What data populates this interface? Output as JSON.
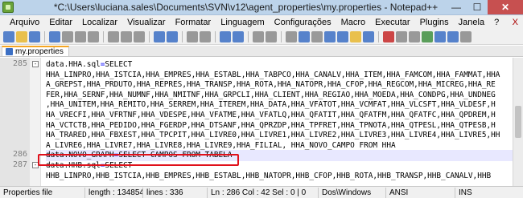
{
  "window": {
    "title": "*C:\\Users\\luciana.sales\\Documents\\SVN\\v12\\agent_properties\\my.properties - Notepad++",
    "minimize_symbol": "—",
    "maximize_symbol": "☐",
    "close_symbol": "✕"
  },
  "menu": {
    "items": [
      "Arquivo",
      "Editar",
      "Localizar",
      "Visualizar",
      "Formatar",
      "Linguagem",
      "Configurações",
      "Macro",
      "Executar",
      "Plugins",
      "Janela",
      "?"
    ],
    "close_symbol": "X"
  },
  "toolbar": {
    "icons": [
      "new-file-icon",
      "open-file-icon",
      "save-icon",
      "save-all-icon",
      "close-file-icon",
      "close-all-icon",
      "print-icon",
      "cut-icon",
      "copy-icon",
      "paste-icon",
      "undo-icon",
      "redo-icon",
      "find-icon",
      "replace-icon",
      "zoom-in-icon",
      "zoom-out-icon",
      "sync-v-icon",
      "sync-h-icon",
      "word-wrap-icon",
      "show-all-chars-icon",
      "indent-guide-icon",
      "doc-map-icon",
      "function-list-icon",
      "folder-icon",
      "monitor-icon",
      "record-macro-icon",
      "stop-macro-icon",
      "play-macro-icon",
      "run-macro-icon",
      "save-macro-icon",
      "spell-check-icon",
      "abc-icon"
    ],
    "colors": {
      "blue": "#3b6fc4",
      "yellow": "#e8b730",
      "red": "#c62828",
      "gray": "#8a8a8a",
      "green": "#3f8f3f"
    }
  },
  "tab": {
    "label": "my.properties"
  },
  "editor": {
    "lines": [
      {
        "number": "285",
        "key": "data.HHA.sql",
        "eq": "=",
        "value": "SELECT",
        "fold": "-"
      },
      {
        "number": "",
        "text": "HHA_LINPRO,HHA_ISTCIA,HHA_EMPRES,HHA_ESTABL,HHA_TABPCO,HHA_CANALV,HHA_ITEM,HHA_FAMCOM,HHA_FAMMAT,HHA"
      },
      {
        "number": "",
        "text": "A_GREPST,HHA_PRDUTO,HHA_REPRES,HHA_TRANSP,HHA_ROTA,HHA_NATOPR,HHA_CFOP,HHA_REGCOM,HHA_MICREG,HHA_RE"
      },
      {
        "number": "",
        "text": "FER,HHA_SERNF,HHA_NUMNF,HHA_NMITNF,HHA_GRPCLI,HHA_CLIENT,HHA_REGIAO,HHA_MOEDA,HHA_CONDPG,HHA_UNDNEG"
      },
      {
        "number": "",
        "text": ",HHA_UNITEM,HHA_REMITO,HHA_SERREM,HHA_ITEREM,HHA_DATA,HHA_VFATOT,HHA_VCMFAT,HHA_VLCSFT,HHA_VLDESF,H"
      },
      {
        "number": "",
        "text": "HA_VRECFI,HHA_VFRTNF,HHA_VDESPE,HHA_VFATME,HHA_VFATLQ,HHA_QFATIT,HHA_QFATFM,HHA_QFATFC,HHA_QPDREM,H"
      },
      {
        "number": "",
        "text": "HA_VCTCTB,HHA_PEDIDO,HHA_FGERDP,HHA_DTSANF,HHA_QPRZDP,HHA_TPFRET,HHA_TPNOTA,HHA_QTPESL,HHA_QTPESB,H"
      },
      {
        "number": "",
        "text": "HA_TRARED,HHA_FBXEST,HHA_TPCPIT,HHA_LIVRE0,HHA_LIVRE1,HHA_LIVRE2,HHA_LIVRE3,HHA_LIVRE4,HHA_LIVRE5,HH"
      },
      {
        "number": "",
        "text": "A_LIVRE6,HHA_LIVRE7,HHA_LIVRE8,HHA_LIVRE9,HHA_FILIAL, HHA_NOVO_CAMPO FROM HHA"
      },
      {
        "number": "286",
        "key": "data.NOVO_GRAPH",
        "eq": "=",
        "value": "SELECT CAMPOS FROM TABELA",
        "current": true
      },
      {
        "number": "287",
        "key": "data.HHB.sql",
        "eq": "=",
        "value": "SELECT",
        "fold": "-"
      },
      {
        "number": "",
        "text": "HHB_LINPRO,HHB_ISTCIA,HHB_EMPRES,HHB_ESTABL,HHB_NATOPR,HHB_CFOP,HHB_ROTA,HHB_TRANSP,HHB_CANALV,HHB"
      }
    ],
    "highlight_color": "#e0101a"
  },
  "status": {
    "file_type": "Properties file",
    "length": "length : 134854",
    "lines": "lines : 336",
    "position": "Ln : 286   Col : 42   Sel : 0 | 0",
    "eol": "Dos\\Windows",
    "encoding": "ANSI",
    "mode": "INS"
  }
}
